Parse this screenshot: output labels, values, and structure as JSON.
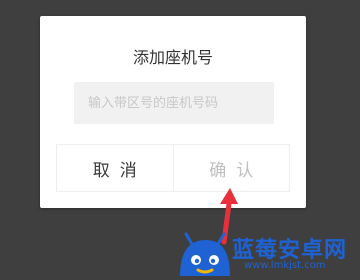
{
  "dialog": {
    "title": "添加座机号",
    "input_placeholder": "输入带区号的座机号码",
    "cancel_label": "取消",
    "confirm_label": "确认"
  },
  "watermark": {
    "brand": "蓝莓安卓网",
    "url": "www.lmkjst.com"
  },
  "colors": {
    "background": "#3f3f3f",
    "dialog": "#ffffff",
    "arrow": "#e8303c",
    "watermark_blue": "#1e62d4"
  }
}
